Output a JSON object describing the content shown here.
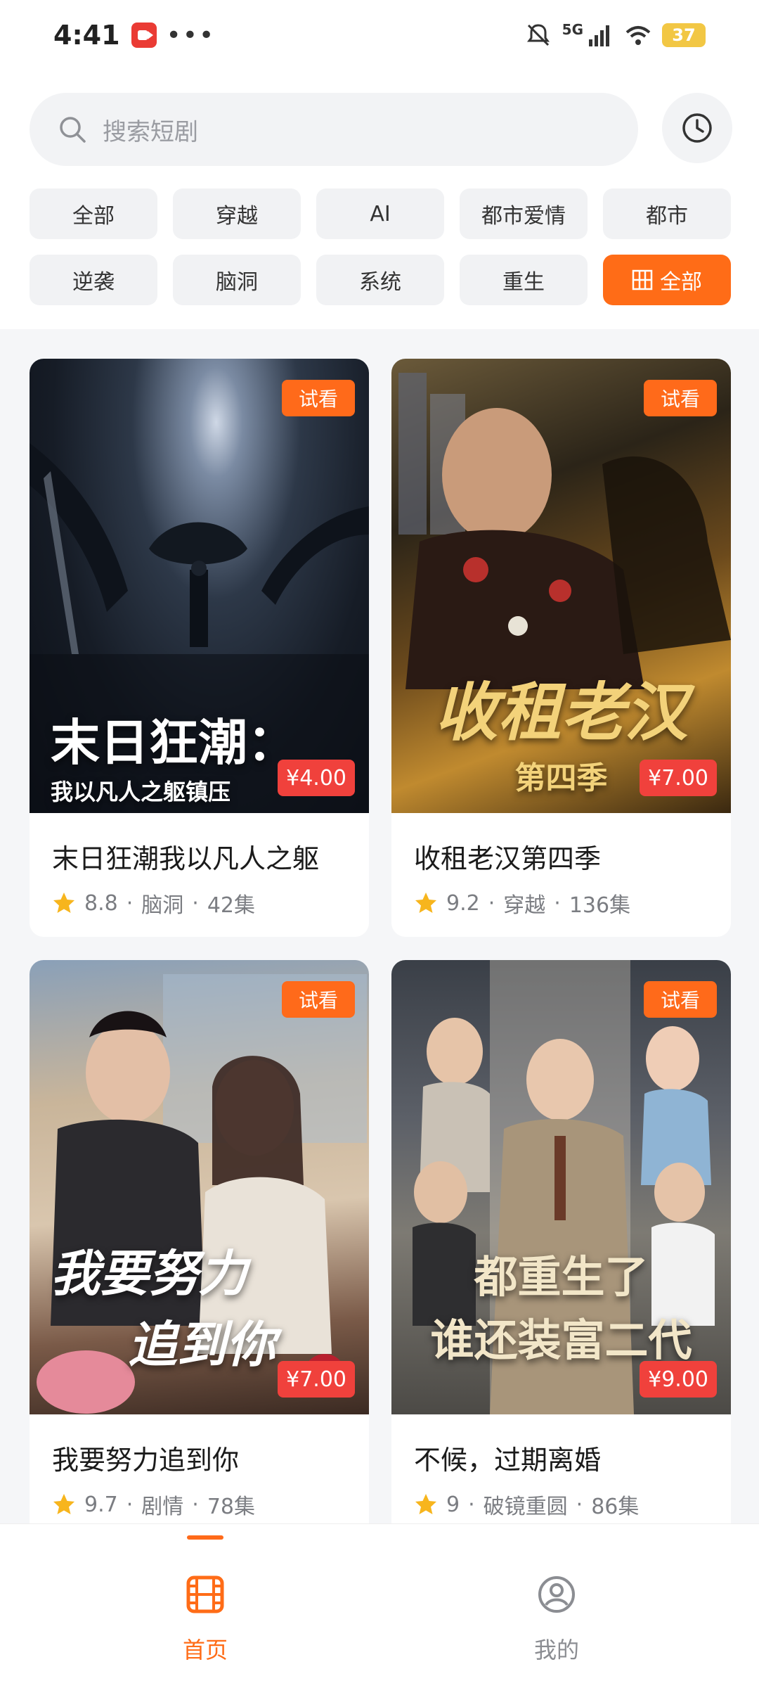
{
  "status_bar": {
    "time": "4:41",
    "network": "5G",
    "battery": "37"
  },
  "search": {
    "placeholder": "搜索短剧"
  },
  "chips": {
    "row1": [
      "全部",
      "穿越",
      "AI",
      "都市爱情",
      "都市"
    ],
    "row2": [
      "逆袭",
      "脑洞",
      "系统",
      "重生"
    ],
    "all_button": "全部"
  },
  "cards": [
    {
      "trial": "试看",
      "price": "¥4.00",
      "poster_line1": "末日狂潮：",
      "poster_line2": "我以凡人之躯镇压",
      "title": "末日狂潮我以凡人之躯",
      "rating": "8.8",
      "genre": "脑洞",
      "episodes": "42集"
    },
    {
      "trial": "试看",
      "price": "¥7.00",
      "poster_line1": "收租老汉",
      "poster_line2": "第四季",
      "title": "收租老汉第四季",
      "rating": "9.2",
      "genre": "穿越",
      "episodes": "136集"
    },
    {
      "trial": "试看",
      "price": "¥7.00",
      "poster_line1": "我要努力",
      "poster_line2": "追到你",
      "title": "我要努力追到你",
      "rating": "9.7",
      "genre": "剧情",
      "episodes": "78集"
    },
    {
      "trial": "试看",
      "price": "¥9.00",
      "poster_line1": "都重生了",
      "poster_line2": "谁还装富二代",
      "title": "不候，过期离婚",
      "rating": "9",
      "genre": "破镜重圆",
      "episodes": "86集"
    }
  ],
  "meta_separator": "·",
  "nav": {
    "home": "首页",
    "mine": "我的"
  },
  "colors": {
    "accent": "#ff6c17",
    "price": "#f0413c"
  }
}
